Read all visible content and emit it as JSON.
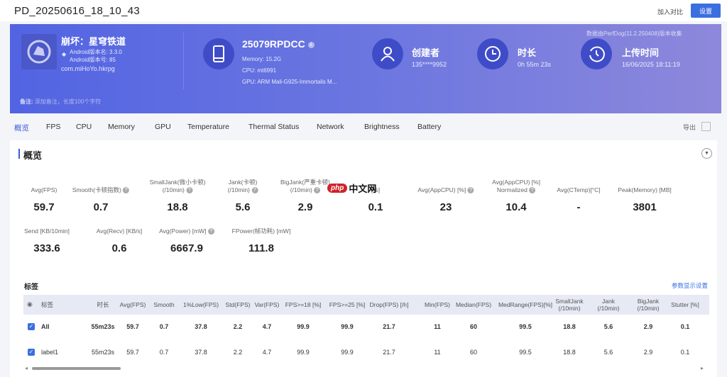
{
  "header": {
    "title": "PD_20250616_18_10_43",
    "compare_button": "加入对比",
    "settings_button": "设置"
  },
  "banner": {
    "app": {
      "name": "崩坏：星穹铁道",
      "version_name": "Android版本名: 3.3.0",
      "version_code": "Android版本号: 85",
      "package": "com.miHoYo.hkrpg"
    },
    "device": {
      "model": "25079RPDCC",
      "memory": "Memory: 15.2G",
      "cpu": "CPU: mt6991",
      "gpu": "GPU: ARM Mali-G925-Immortalis M..."
    },
    "creator": {
      "label": "创建者",
      "value": "135****9952"
    },
    "duration": {
      "label": "时长",
      "value": "0h 55m 23s"
    },
    "upload": {
      "label": "上传时间",
      "value": "16/06/2025 18:11:19"
    },
    "version_note": "数据由PerfDog(11.2.250408)版本收集",
    "note_label": "备注:",
    "note_placeholder": "添加备注，长度100个字符"
  },
  "tabs": [
    "概览",
    "FPS",
    "CPU",
    "Memory",
    "GPU",
    "Temperature",
    "Thermal Status",
    "Network",
    "Brightness",
    "Battery"
  ],
  "export_label": "导出",
  "overview": {
    "title": "概览",
    "row1": [
      {
        "label": "Avg(FPS)",
        "value": "59.7"
      },
      {
        "label": "Smooth(卡顿指数)",
        "value": "0.7"
      },
      {
        "label": "SmallJank(微小卡顿)",
        "label2": "(/10min)",
        "value": "18.8"
      },
      {
        "label": "Jank(卡顿)",
        "label2": "(/10min)",
        "value": "5.6"
      },
      {
        "label": "BigJank(严重卡顿)",
        "label2": "(/10min)",
        "value": "2.9"
      },
      {
        "label": "[%]",
        "value": "0.1"
      },
      {
        "label": "Avg(AppCPU) [%]",
        "value": "23"
      },
      {
        "label": "Avg(AppCPU) [%]",
        "label2": "Normalized",
        "value": "10.4"
      },
      {
        "label": "Avg(CTemp)[°C]",
        "value": "-"
      },
      {
        "label": "Peak(Memory) [MB]",
        "value": "3801"
      }
    ],
    "row2": [
      {
        "label": "Send [KB/10min]",
        "value": "333.6"
      },
      {
        "label": "Avg(Recv) [KB/s]",
        "value": "0.6"
      },
      {
        "label": "Avg(Power) [mW]",
        "value": "6667.9"
      },
      {
        "label": "FPower(帧功耗) [mW]",
        "value": "111.8"
      }
    ]
  },
  "watermark": {
    "php": "php",
    "cn": "中文网"
  },
  "labels_section": {
    "title": "标签",
    "settings_link": "参数显示设置",
    "headers": [
      "标签",
      "时长",
      "Avg(FPS)",
      "Smooth",
      "1%Low(FPS)",
      "Std(FPS)",
      "Var(FPS)",
      "FPS>=18 [%]",
      "FPS>=25 [%]",
      "Drop(FPS) [/h]",
      "Min(FPS)",
      "Median(FPS)",
      "MedRange(FPS)[%]",
      "SmallJank (/10min)",
      "Jank (/10min)",
      "BigJank (/10min)",
      "Stutter [%]"
    ],
    "rows": [
      [
        "All",
        "55m23s",
        "59.7",
        "0.7",
        "37.8",
        "2.2",
        "4.7",
        "99.9",
        "99.9",
        "21.7",
        "11",
        "60",
        "99.5",
        "18.8",
        "5.6",
        "2.9",
        "0.1"
      ],
      [
        "label1",
        "55m23s",
        "59.7",
        "0.7",
        "37.8",
        "2.2",
        "4.7",
        "99.9",
        "99.9",
        "21.7",
        "11",
        "60",
        "99.5",
        "18.8",
        "5.6",
        "2.9",
        "0.1"
      ]
    ]
  },
  "colors": {
    "accent": "#3b6fe0",
    "banner_start": "#5264e2",
    "banner_end": "#8d88db"
  }
}
